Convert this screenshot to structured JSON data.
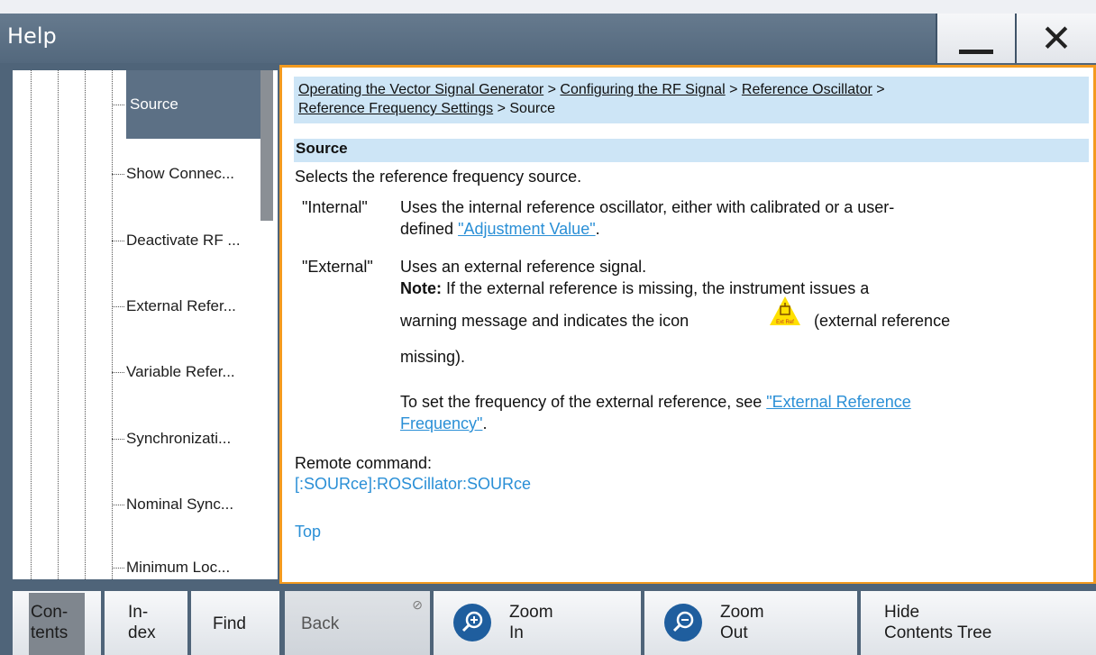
{
  "window": {
    "title": "Help",
    "minimize_label": "—",
    "close_label": "✕"
  },
  "tree": {
    "items": [
      {
        "label": "Source",
        "selected": true
      },
      {
        "label": "Show Connec..."
      },
      {
        "label": "Deactivate RF ..."
      },
      {
        "label": "External Refer..."
      },
      {
        "label": "Variable Refer..."
      },
      {
        "label": "Synchronizati..."
      },
      {
        "label": "Nominal Sync..."
      },
      {
        "label": "Minimum Loc..."
      }
    ]
  },
  "content": {
    "breadcrumb": {
      "crumb1": "Operating the Vector Signal Generator",
      "crumb2": "Configuring the RF Signal",
      "crumb3": "Reference Oscillator",
      "crumb4": "Reference Frequency Settings",
      "current": "Source",
      "sep": ">"
    },
    "section_title": "Source",
    "description": "Selects the reference frequency source.",
    "internal": {
      "term": "\"Internal\"",
      "text1": "Uses the internal reference oscillator, either with calibrated or a user-",
      "text2_pre": "defined ",
      "link": "\"Adjustment Value\"",
      "text2_post": "."
    },
    "external": {
      "term": "\"External\"",
      "text1": "Uses an external reference signal.",
      "note_label": "Note:",
      "note_text": " If the external reference is missing, the instrument issues a",
      "line3_pre": "warning message and indicates the icon",
      "line3_post": "(external reference",
      "line4": "missing).",
      "set_text": "To set the frequency of the external reference, see ",
      "set_link1": "\"External Reference",
      "set_link2": "Frequency\"",
      "set_end": ".",
      "icon_label": "Ext Ref"
    },
    "remote_label": "Remote command:",
    "remote_cmd": "[:SOURce]:ROSCillator:SOURce",
    "top_link": "Top"
  },
  "toolbar": {
    "contents": [
      "Con-",
      "tents"
    ],
    "index": [
      "In-",
      "dex"
    ],
    "find": "Find",
    "back": "Back",
    "zoom_in": [
      "Zoom",
      "In"
    ],
    "zoom_out": [
      "Zoom",
      "Out"
    ],
    "hide": [
      "Hide",
      "Contents Tree"
    ]
  }
}
